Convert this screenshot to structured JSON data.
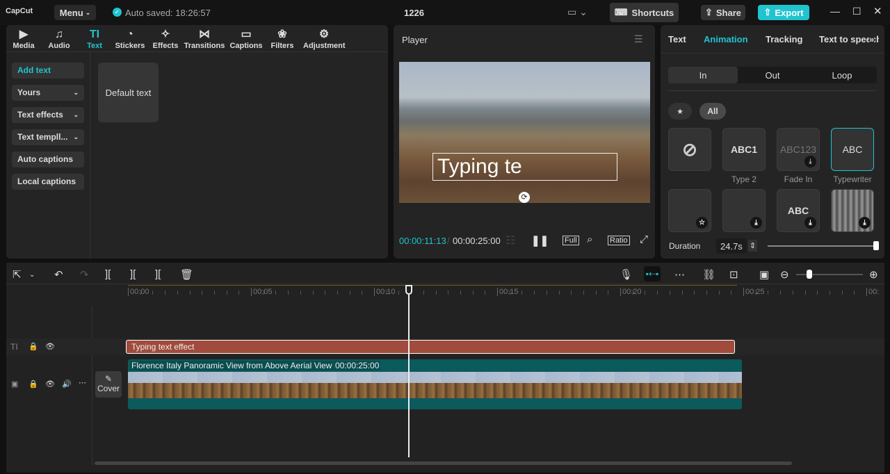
{
  "app": {
    "logo": "CapCut",
    "menu": "Menu",
    "autosave": "Auto saved: 18:26:57",
    "project": "1226",
    "shortcuts": "Shortcuts",
    "share": "Share",
    "export": "Export"
  },
  "toolbar": [
    {
      "label": "Media",
      "icon": "▶"
    },
    {
      "label": "Audio",
      "icon": "♫"
    },
    {
      "label": "Text",
      "icon": "TI"
    },
    {
      "label": "Stickers",
      "icon": "◔"
    },
    {
      "label": "Effects",
      "icon": "✧"
    },
    {
      "label": "Transitions",
      "icon": "⋈"
    },
    {
      "label": "Captions",
      "icon": "▭"
    },
    {
      "label": "Filters",
      "icon": "❀"
    },
    {
      "label": "Adjustment",
      "icon": "⚙"
    }
  ],
  "sidebar": {
    "add_text": "Add text",
    "yours": "Yours",
    "text_effects": "Text effects",
    "text_templates": "Text templl...",
    "auto_captions": "Auto captions",
    "local_captions": "Local captions"
  },
  "default_text": "Default text",
  "player": {
    "title": "Player",
    "overlay_text": "Typing te",
    "current": "00:00:11:13",
    "total": "00:00:25:00",
    "full": "Full",
    "ratio": "Ratio"
  },
  "right": {
    "tabs": [
      "Text",
      "Animation",
      "Tracking",
      "Text to speech"
    ],
    "segments": [
      "In",
      "Out",
      "Loop"
    ],
    "filter_all": "All",
    "cards": [
      {
        "label": "",
        "preview": ""
      },
      {
        "label": "Type 2",
        "preview": "ABC1"
      },
      {
        "label": "Fade In",
        "preview": "ABC123"
      },
      {
        "label": "Typewriter",
        "preview": "ABC"
      },
      {
        "label": "",
        "preview": ""
      },
      {
        "label": "",
        "preview": ""
      },
      {
        "label": "",
        "preview": "ABC"
      },
      {
        "label": "",
        "preview": ""
      }
    ],
    "duration_label": "Duration",
    "duration_value": "24.7s",
    "duration_fraction": 1.0
  },
  "timeline": {
    "ticks": [
      "00:00",
      "00:05",
      "00:10",
      "00:15",
      "00:20",
      "00:25",
      "00:"
    ],
    "playhead_seconds": 11.4,
    "text_clip": "Typing text effect",
    "video_clip": "Florence Italy Panoramic View from Above Aerial View",
    "video_duration": "00:00:25:00",
    "cover": "Cover",
    "zoom_fraction": 0.2
  },
  "colors": {
    "accent": "#20c4cf",
    "text_clip": "#a04b3c",
    "video_clip": "#0b5a5c"
  }
}
